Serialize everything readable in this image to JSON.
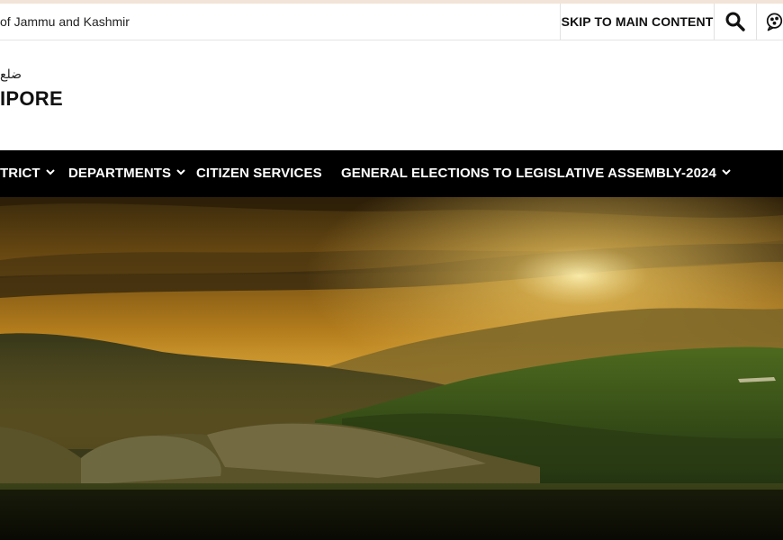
{
  "topbar": {
    "gov_text": "of Jammu and Kashmir",
    "skip_label": "SKIP TO MAIN CONTENT",
    "search_icon": "search-icon",
    "social_icon": "social-share-icon"
  },
  "brand": {
    "urdu_text": "ضلع",
    "district_name": "IPORE"
  },
  "nav": {
    "items": [
      {
        "label": "TRICT",
        "has_dropdown": true
      },
      {
        "label": "DEPARTMENTS",
        "has_dropdown": true
      },
      {
        "label": "CITIZEN SERVICES",
        "has_dropdown": false
      },
      {
        "label": "GENERAL ELECTIONS TO LEGISLATIVE ASSEMBLY-2024",
        "has_dropdown": true
      }
    ]
  },
  "hero": {
    "description_icon": "landscape-banner-image"
  },
  "colors": {
    "nav_bg": "#000000",
    "topbar_accent": "#f2e4d8",
    "text": "#111111"
  }
}
